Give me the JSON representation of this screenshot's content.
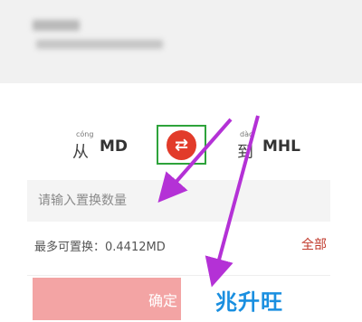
{
  "header": {
    "title": "",
    "subtitle": ""
  },
  "swap": {
    "from_label": "从",
    "from_pinyin": "cóng",
    "from_coin": "MD",
    "swap_icon": "⇄",
    "to_label": "到",
    "to_pinyin": "dào",
    "to_coin": "MHL"
  },
  "amount": {
    "placeholder": "请输入置换数量"
  },
  "max": {
    "label": "最多可置换：0.4412MD"
  },
  "all_link": "全部",
  "confirm_label": "确定",
  "watermark": "兆升旺",
  "colors": {
    "accent": "#e23b2a",
    "highlight": "#2ea33b",
    "arrow": "#b431d6",
    "confirm": "#f3a4a4"
  }
}
